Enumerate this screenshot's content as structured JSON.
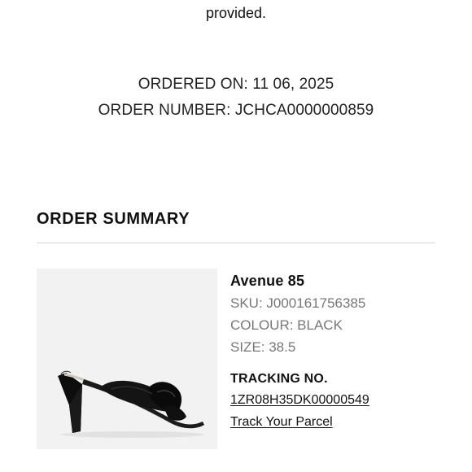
{
  "intro": {
    "tail_text": "provided."
  },
  "order": {
    "ordered_on": "ORDERED ON: 11 06, 2025",
    "order_number": "ORDER NUMBER: JCHCA0000000859"
  },
  "summary": {
    "title": "ORDER SUMMARY"
  },
  "product": {
    "name": "Avenue 85",
    "sku": "SKU: J000161756385",
    "colour": "COLOUR: BLACK",
    "size": "SIZE: 38.5",
    "image": "black-knotted-heeled-mule-sandal"
  },
  "tracking": {
    "title": "TRACKING NO.",
    "number": "1ZR08H35DK00000549",
    "track_label": "Track Your Parcel"
  },
  "colors": {
    "text": "#111111",
    "muted": "#777777",
    "divider": "#d8d8d8",
    "image_bg": "#f2f2f2"
  }
}
